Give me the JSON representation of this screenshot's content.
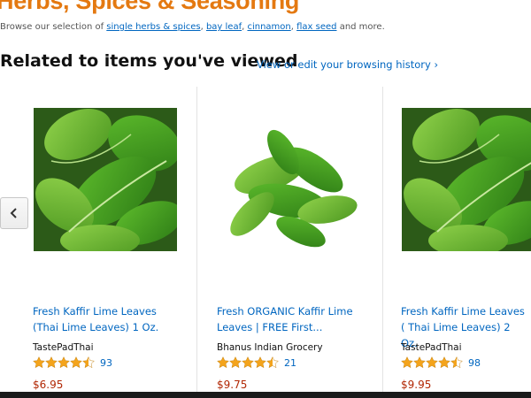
{
  "header": {
    "title": "Herbs, Spices & Seasoning",
    "browse_prefix": "Browse our selection of",
    "browse_links": [
      "single herbs & spices",
      "bay leaf",
      "cinnamon",
      "flax seed"
    ],
    "browse_suffix": "and more."
  },
  "related": {
    "heading": "Related to items you've viewed",
    "link": "View or edit your browsing history ›"
  },
  "products": [
    {
      "title": "Fresh Kaffir Lime Leaves (Thai Lime Leaves) 1 Oz.",
      "seller": "TastePadThai",
      "rating": 4.5,
      "reviews": "93",
      "price": "$6.95"
    },
    {
      "title": "Fresh ORGANIC Kaffir Lime Leaves | FREE First...",
      "seller": "Bhanus Indian Grocery",
      "rating": 4.5,
      "reviews": "21",
      "price": "$9.75"
    },
    {
      "title": "Fresh Kaffir Lime Leaves ( Thai Lime Leaves) 2 Oz.",
      "seller": "TastePadThai",
      "rating": 4.5,
      "reviews": "98",
      "price": "$9.95"
    }
  ],
  "colors": {
    "title": "#e47911",
    "link": "#0066c0",
    "price": "#b12704",
    "star": "#f4a41c"
  },
  "icons": {
    "prev": "chevron-left-icon",
    "star": "star-icon"
  }
}
